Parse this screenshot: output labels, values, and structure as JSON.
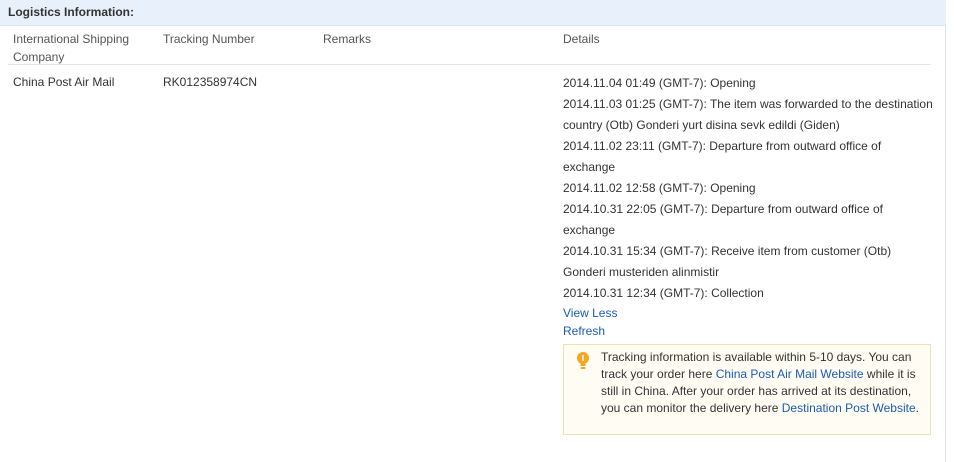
{
  "section": {
    "title": "Logistics Information:"
  },
  "table": {
    "headers": {
      "company": "International Shipping Company",
      "tracking": "Tracking Number",
      "remarks": "Remarks",
      "details": "Details"
    },
    "row": {
      "company": "China Post Air Mail",
      "tracking": "RK012358974CN",
      "remarks": ""
    }
  },
  "details": {
    "events": [
      "2014.11.04 01:49 (GMT-7): Opening",
      "2014.11.03 01:25 (GMT-7): The item was forwarded to the destination country (Otb) Gonderi yurt disina sevk edildi (Giden)",
      "2014.11.02 23:11 (GMT-7): Departure from outward office of exchange",
      "2014.11.02 12:58 (GMT-7): Opening",
      "2014.10.31 22:05 (GMT-7): Departure from outward office of exchange",
      "2014.10.31 15:34 (GMT-7): Receive item from customer (Otb) Gonderi musteriden alinmistir",
      "2014.10.31 12:34 (GMT-7): Collection"
    ],
    "view_less": "View Less",
    "refresh": "Refresh"
  },
  "notice": {
    "icon": "lightbulb-icon",
    "text1": "Tracking information is available within 5-10 days. You can track your order here ",
    "link1": "China Post Air Mail Website",
    "text2": " while it is still in China. After your order has arrived at its destination, you can monitor the delivery here ",
    "link2": "Destination Post Website",
    "text3": "."
  },
  "colors": {
    "header_bg": "#e8f0fb",
    "link": "#1a5bb5",
    "notice_border": "#f0e2b0",
    "icon": "#f5a623"
  }
}
